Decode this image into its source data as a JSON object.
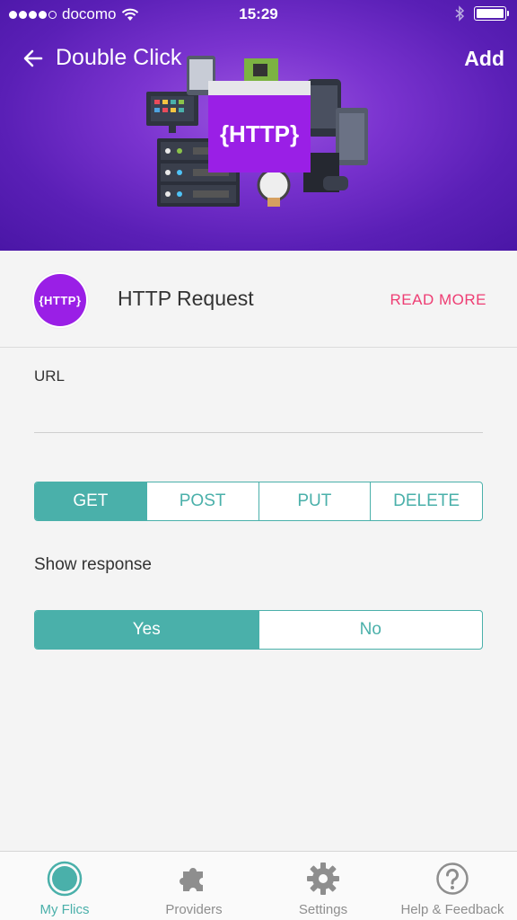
{
  "status": {
    "carrier": "docomo",
    "time": "15:29"
  },
  "header": {
    "back_label": "Double Click",
    "add_label": "Add"
  },
  "illustration": {
    "badge_text": "{HTTP}"
  },
  "service": {
    "logo_text": "{HTTP}",
    "title": "HTTP Request",
    "read_more": "READ MORE"
  },
  "form": {
    "url_label": "URL",
    "url_value": "",
    "methods": [
      "GET",
      "POST",
      "PUT",
      "DELETE"
    ],
    "selected_method": "GET",
    "show_response_label": "Show response",
    "response_options": [
      "Yes",
      "No"
    ],
    "selected_response": "Yes"
  },
  "tabs": [
    {
      "label": "My Flics",
      "icon": "flic-button-icon",
      "active": true
    },
    {
      "label": "Providers",
      "icon": "puzzle-icon",
      "active": false
    },
    {
      "label": "Settings",
      "icon": "gear-icon",
      "active": false
    },
    {
      "label": "Help & Feedback",
      "icon": "help-icon",
      "active": false
    }
  ],
  "colors": {
    "accent": "#4ab0aa",
    "link": "#ee3d73",
    "header_purple": "#7a33cf",
    "http_purple": "#9a1fe6"
  }
}
